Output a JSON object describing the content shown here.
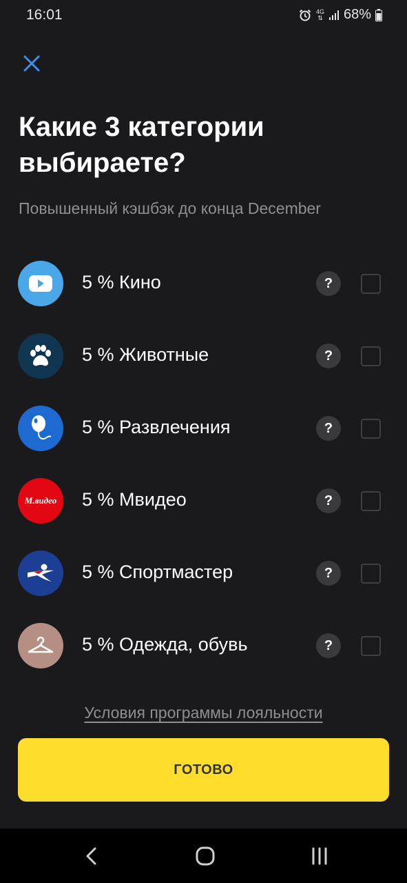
{
  "status_bar": {
    "time": "16:01",
    "network": "4G",
    "battery": "68%"
  },
  "close_button": {
    "icon": "close-icon",
    "color": "#3d8ef0"
  },
  "title": "Какие 3 категории выбираете?",
  "subtitle": "Повышенный кэшбэк до конца December",
  "categories": [
    {
      "label": "5 % Кино",
      "icon": "video-play-icon",
      "icon_bg": "#4aa8e8",
      "checked": false
    },
    {
      "label": "5 % Животные",
      "icon": "paw-icon",
      "icon_bg": "#0f3550",
      "checked": false
    },
    {
      "label": "5 % Развлечения",
      "icon": "balloon-icon",
      "icon_bg": "#1d6ad1",
      "checked": false
    },
    {
      "label": "5 % Мвидео",
      "icon": "mvideo-logo",
      "icon_bg": "#e30613",
      "logo_text": "М.видео",
      "checked": false
    },
    {
      "label": "5 % Спортмастер",
      "icon": "sportmaster-logo",
      "icon_bg": "#1c3f94",
      "checked": false
    },
    {
      "label": "5 % Одежда, обувь",
      "icon": "hanger-icon",
      "icon_bg": "#b58f84",
      "checked": false
    }
  ],
  "help_label": "?",
  "loyalty_link": "Условия программы лояльности",
  "done_button": {
    "label": "ГОТОВО",
    "color": "#ffdd2d"
  },
  "nav": {
    "back": "back-icon",
    "home": "home-icon",
    "recents": "recents-icon"
  }
}
